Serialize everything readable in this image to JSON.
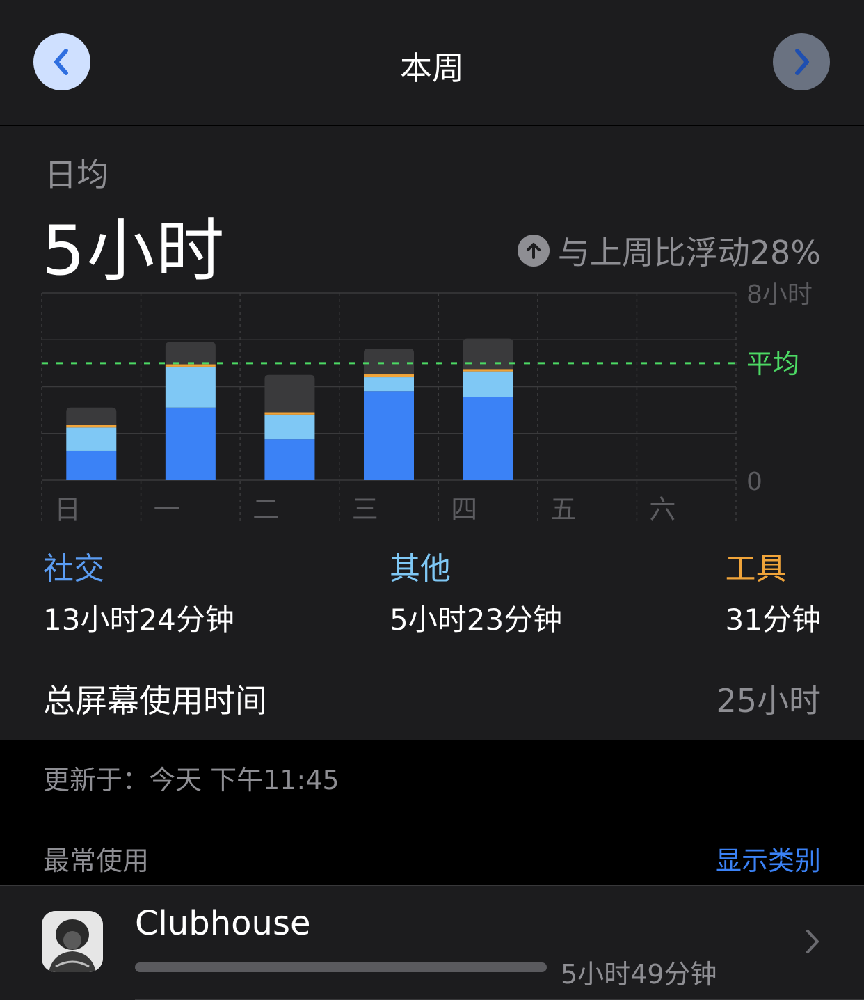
{
  "header": {
    "title": "本周",
    "prev_icon": "chevron-left-icon",
    "next_icon": "chevron-right-icon"
  },
  "summary": {
    "avg_label": "日均",
    "avg_value": "5小时",
    "delta_icon": "arrow-up-circle-icon",
    "delta_text": "与上周比浮动28%"
  },
  "chart_data": {
    "type": "bar",
    "stacked": true,
    "categories": [
      "日",
      "一",
      "二",
      "三",
      "四",
      "五",
      "六"
    ],
    "y_tick_labels": [
      "8小时",
      "0"
    ],
    "ylim": [
      0,
      8
    ],
    "average_label": "平均",
    "average_value": 5,
    "series": [
      {
        "name": "社交",
        "color": "#3b82f6",
        "values": [
          1.25,
          3.1,
          1.75,
          3.8,
          3.55,
          0,
          0
        ]
      },
      {
        "name": "其他",
        "color": "#7fc8f5",
        "values": [
          1.0,
          1.75,
          1.05,
          0.6,
          1.1,
          0,
          0
        ]
      },
      {
        "name": "工具",
        "color": "#f0a43a",
        "values": [
          0.1,
          0.1,
          0.1,
          0.12,
          0.1,
          0,
          0
        ]
      },
      {
        "color": "#3a3a3c",
        "values": [
          0.75,
          0.95,
          1.6,
          1.1,
          1.3,
          0,
          0
        ]
      }
    ],
    "grid": true
  },
  "legend": {
    "social": {
      "label": "社交",
      "duration": "13小时24分钟"
    },
    "other": {
      "label": "其他",
      "duration": "5小时23分钟"
    },
    "tools": {
      "label": "工具",
      "duration": "31分钟"
    }
  },
  "total": {
    "label": "总屏幕使用时间",
    "value": "25小时"
  },
  "updated": "更新于：今天 下午11:45",
  "most_used": {
    "label": "最常使用",
    "action": "显示类别"
  },
  "apps": [
    {
      "name": "Clubhouse",
      "time": "5小时49分钟",
      "usage_fraction": 1.0,
      "icon": "clubhouse-app-icon"
    }
  ]
}
